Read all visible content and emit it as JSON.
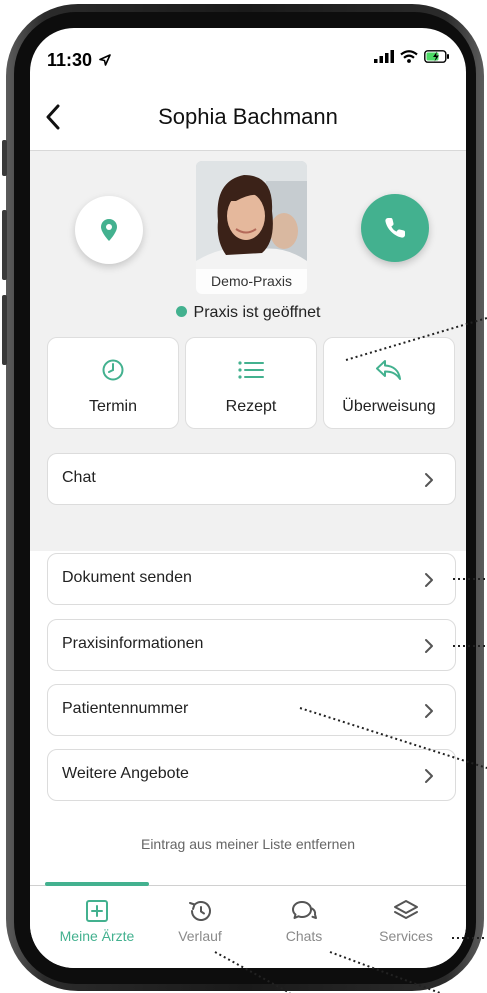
{
  "status_bar": {
    "time": "11:30"
  },
  "header": {
    "title": "Sophia Bachmann"
  },
  "profile": {
    "photo_label": "Demo-Praxis",
    "status_text": "Praxis ist geöffnet",
    "accent_color": "#43b18f"
  },
  "actions": [
    {
      "label": "Termin",
      "icon": "clock-icon"
    },
    {
      "label": "Rezept",
      "icon": "list-icon"
    },
    {
      "label": "Überweisung",
      "icon": "reply-icon"
    }
  ],
  "chat_row": {
    "label": "Chat"
  },
  "menu": [
    {
      "label": "Dokument senden"
    },
    {
      "label": "Praxisinformationen"
    },
    {
      "label": "Patientennummer"
    },
    {
      "label": "Weitere Angebote"
    }
  ],
  "remove_link": "Eintrag aus meiner Liste entfernen",
  "tabs": [
    {
      "label": "Meine Ärzte",
      "icon": "plus-square-icon",
      "active": true
    },
    {
      "label": "Verlauf",
      "icon": "history-icon",
      "active": false
    },
    {
      "label": "Chats",
      "icon": "chat-bubbles-icon",
      "active": false
    },
    {
      "label": "Services",
      "icon": "layers-icon",
      "active": false
    }
  ]
}
